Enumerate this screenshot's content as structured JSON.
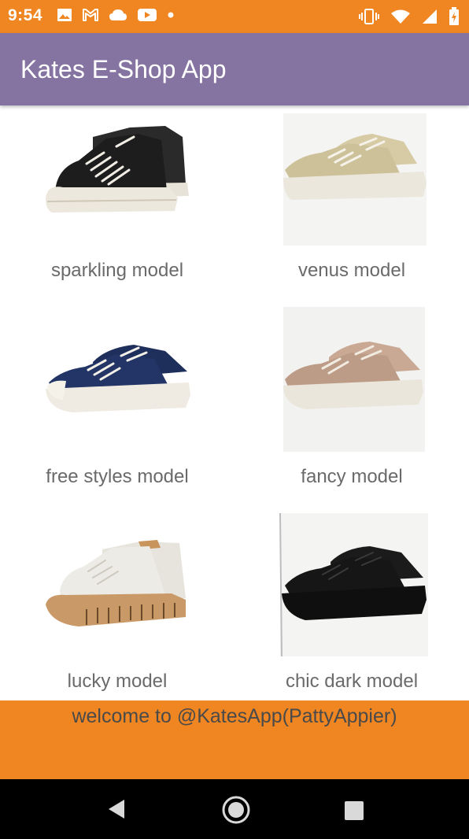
{
  "status_bar": {
    "time": "9:54",
    "left_icons": [
      "image-icon",
      "gmail-icon",
      "cloud-icon",
      "youtube-icon",
      "dot-icon"
    ],
    "right_icons": [
      "vibrate-icon",
      "wifi-icon",
      "signal-icon",
      "battery-icon"
    ],
    "background": "#ef8622"
  },
  "app_bar": {
    "title": "Kates E-Shop App",
    "background": "#8573a1"
  },
  "products": [
    {
      "label": "sparkling model",
      "image": "black-high-top-sneaker-image"
    },
    {
      "label": "venus model",
      "image": "beige-low-top-sneaker-image"
    },
    {
      "label": "free styles model",
      "image": "navy-low-top-sneaker-image"
    },
    {
      "label": "fancy model",
      "image": "tan-low-top-sneaker-image"
    },
    {
      "label": "lucky model",
      "image": "white-high-top-sneaker-image"
    },
    {
      "label": "chic dark model",
      "image": "all-black-low-top-sneaker-image"
    }
  ],
  "footer": {
    "text": "welcome to @KatesApp(PattyAppier)",
    "background": "#ef8622"
  },
  "nav_bar": {
    "buttons": [
      "back-icon",
      "home-icon",
      "recents-icon"
    ]
  }
}
